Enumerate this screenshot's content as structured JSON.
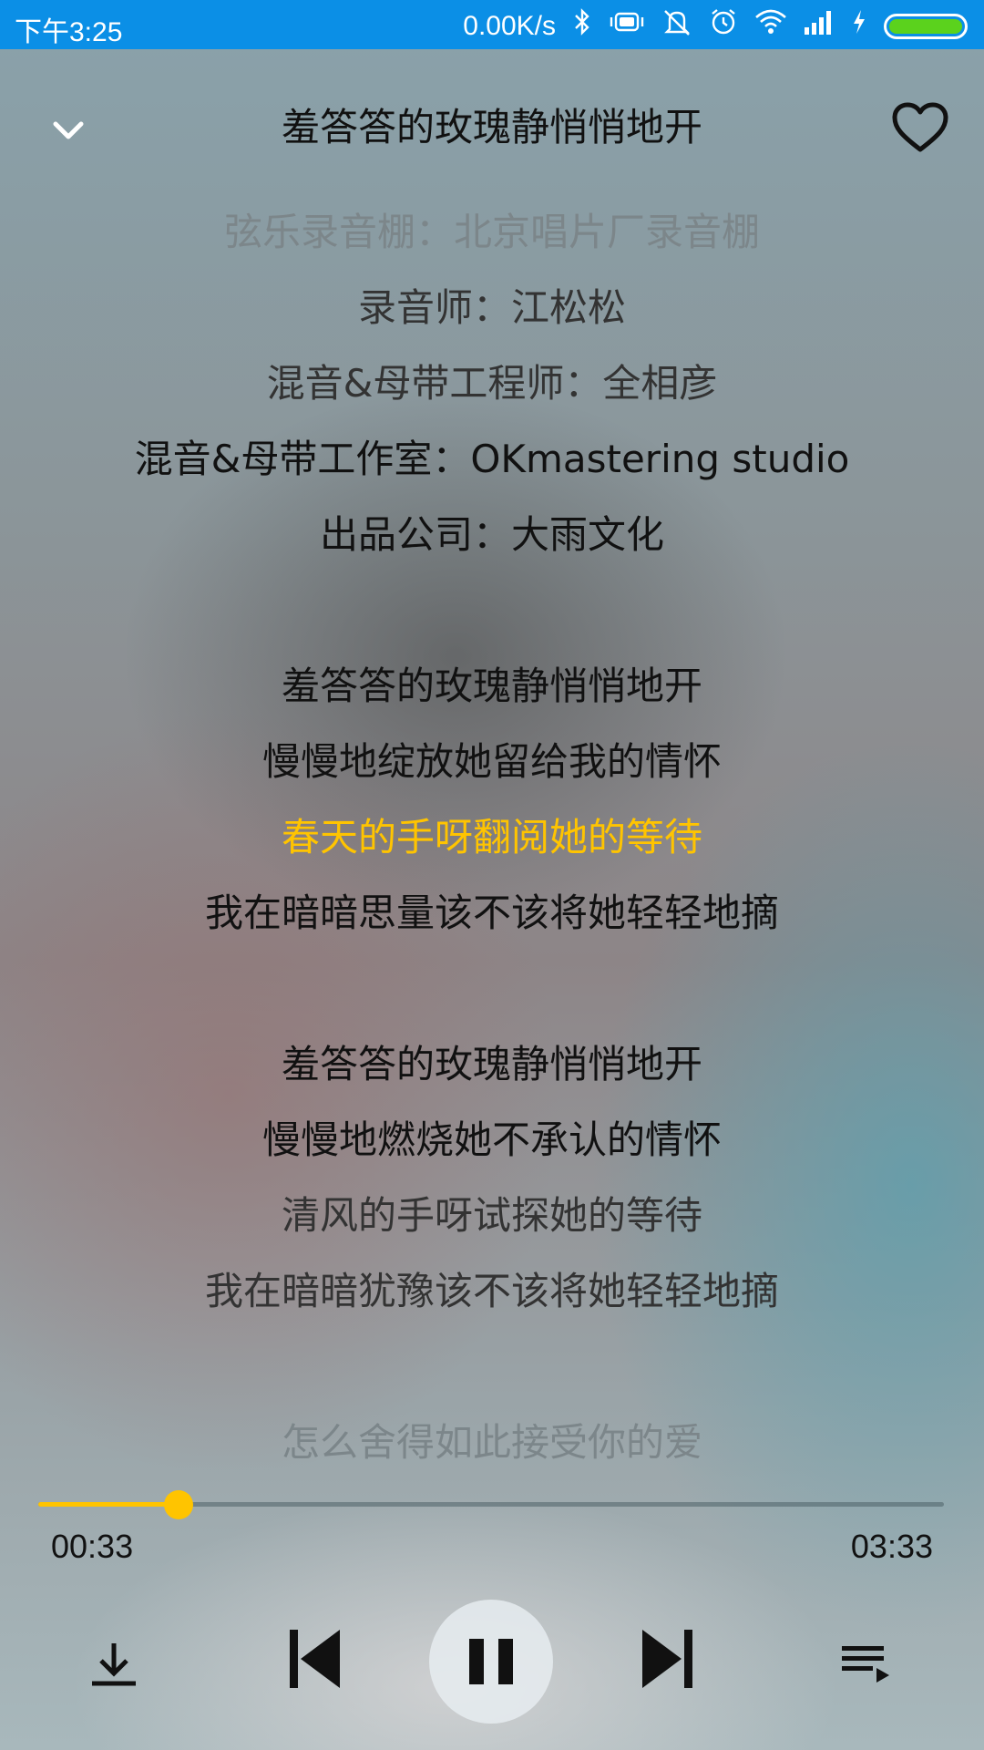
{
  "status_bar": {
    "time": "下午3:25",
    "network_speed": "0.00K/s",
    "icons": [
      "bluetooth-icon",
      "vibrate-icon",
      "mute-icon",
      "alarm-icon",
      "wifi-icon",
      "signal-icon",
      "charging-icon",
      "battery-icon"
    ],
    "battery_color": "#5bd21d",
    "background": "#0b8fe6"
  },
  "header": {
    "title": "羞答答的玫瑰静悄悄地开",
    "collapse_icon": "chevron-down-icon",
    "favorite_icon": "heart-icon"
  },
  "lyrics": {
    "lines": [
      {
        "text": "弦乐录音棚：北京唱片厂录音棚",
        "state": "faded"
      },
      {
        "text": "录音师：江松松",
        "state": "dim"
      },
      {
        "text": "混音&母带工程师：全相彦",
        "state": "dim"
      },
      {
        "text": "混音&母带工作室：OKmastering studio",
        "state": "normal"
      },
      {
        "text": "出品公司：大雨文化",
        "state": "normal"
      },
      {
        "text": "",
        "state": "blank"
      },
      {
        "text": "羞答答的玫瑰静悄悄地开",
        "state": "normal"
      },
      {
        "text": "慢慢地绽放她留给我的情怀",
        "state": "normal"
      },
      {
        "text": "春天的手呀翻阅她的等待",
        "state": "active"
      },
      {
        "text": "我在暗暗思量该不该将她轻轻地摘",
        "state": "normal"
      },
      {
        "text": "",
        "state": "blank"
      },
      {
        "text": "羞答答的玫瑰静悄悄地开",
        "state": "normal"
      },
      {
        "text": "慢慢地燃烧她不承认的情怀",
        "state": "normal"
      },
      {
        "text": "清风的手呀试探她的等待",
        "state": "dim"
      },
      {
        "text": "我在暗暗犹豫该不该将她轻轻地摘",
        "state": "dim"
      },
      {
        "text": "",
        "state": "blank"
      },
      {
        "text": "怎么舍得如此接受你的爱",
        "state": "faded"
      }
    ],
    "colors": {
      "normal": "#111111",
      "dim": "#333333",
      "faded": "#7c868a",
      "active": "#ffc400"
    }
  },
  "player": {
    "current_time": "00:33",
    "total_time": "03:33",
    "progress_fraction": 0.155,
    "accent_color": "#ffc400"
  },
  "controls": {
    "download_icon": "download-icon",
    "previous_icon": "skip-previous-icon",
    "pause_icon": "pause-icon",
    "next_icon": "skip-next-icon",
    "playlist_icon": "playlist-icon"
  }
}
